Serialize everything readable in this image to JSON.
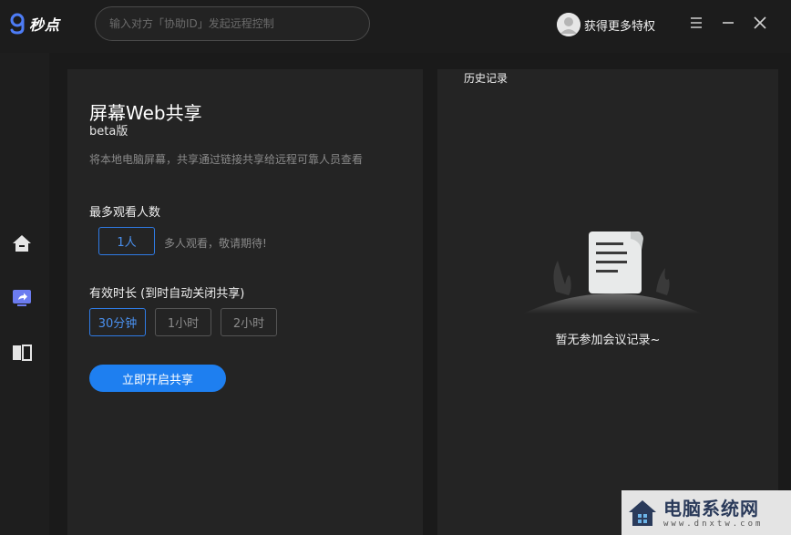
{
  "app": {
    "logo_text": "秒点"
  },
  "search": {
    "placeholder": "输入对方「协助ID」发起远程控制"
  },
  "user": {
    "label": "获得更多特权"
  },
  "window_controls": [
    "menu-icon",
    "minimize-icon",
    "close-icon"
  ],
  "sidebar": {
    "items": [
      {
        "icon": "home-icon",
        "active": false
      },
      {
        "icon": "screen-share-icon",
        "active": true
      },
      {
        "icon": "split-view-icon",
        "active": false
      }
    ]
  },
  "share": {
    "title": "屏幕Web共享",
    "subtitle": "beta版",
    "description": "将本地电脑屏幕，共享通过链接共享给远程可靠人员查看",
    "viewers": {
      "label": "最多观看人数",
      "options": [
        "1人"
      ],
      "selected": "1人",
      "hint": "多人观看，敬请期待!"
    },
    "duration": {
      "label": "有效时长 (到时自动关闭共享)",
      "options": [
        "30分钟",
        "1小时",
        "2小时"
      ],
      "selected": "30分钟"
    },
    "start_button": "立即开启共享"
  },
  "history": {
    "title": "历史记录",
    "empty_text": "暂无参加会议记录~"
  },
  "watermark": {
    "text": "电脑系统网",
    "url": "www.dnxtw.com"
  },
  "colors": {
    "accent": "#1e7ff0",
    "background": "#1a1a1a",
    "panel": "#242424"
  }
}
